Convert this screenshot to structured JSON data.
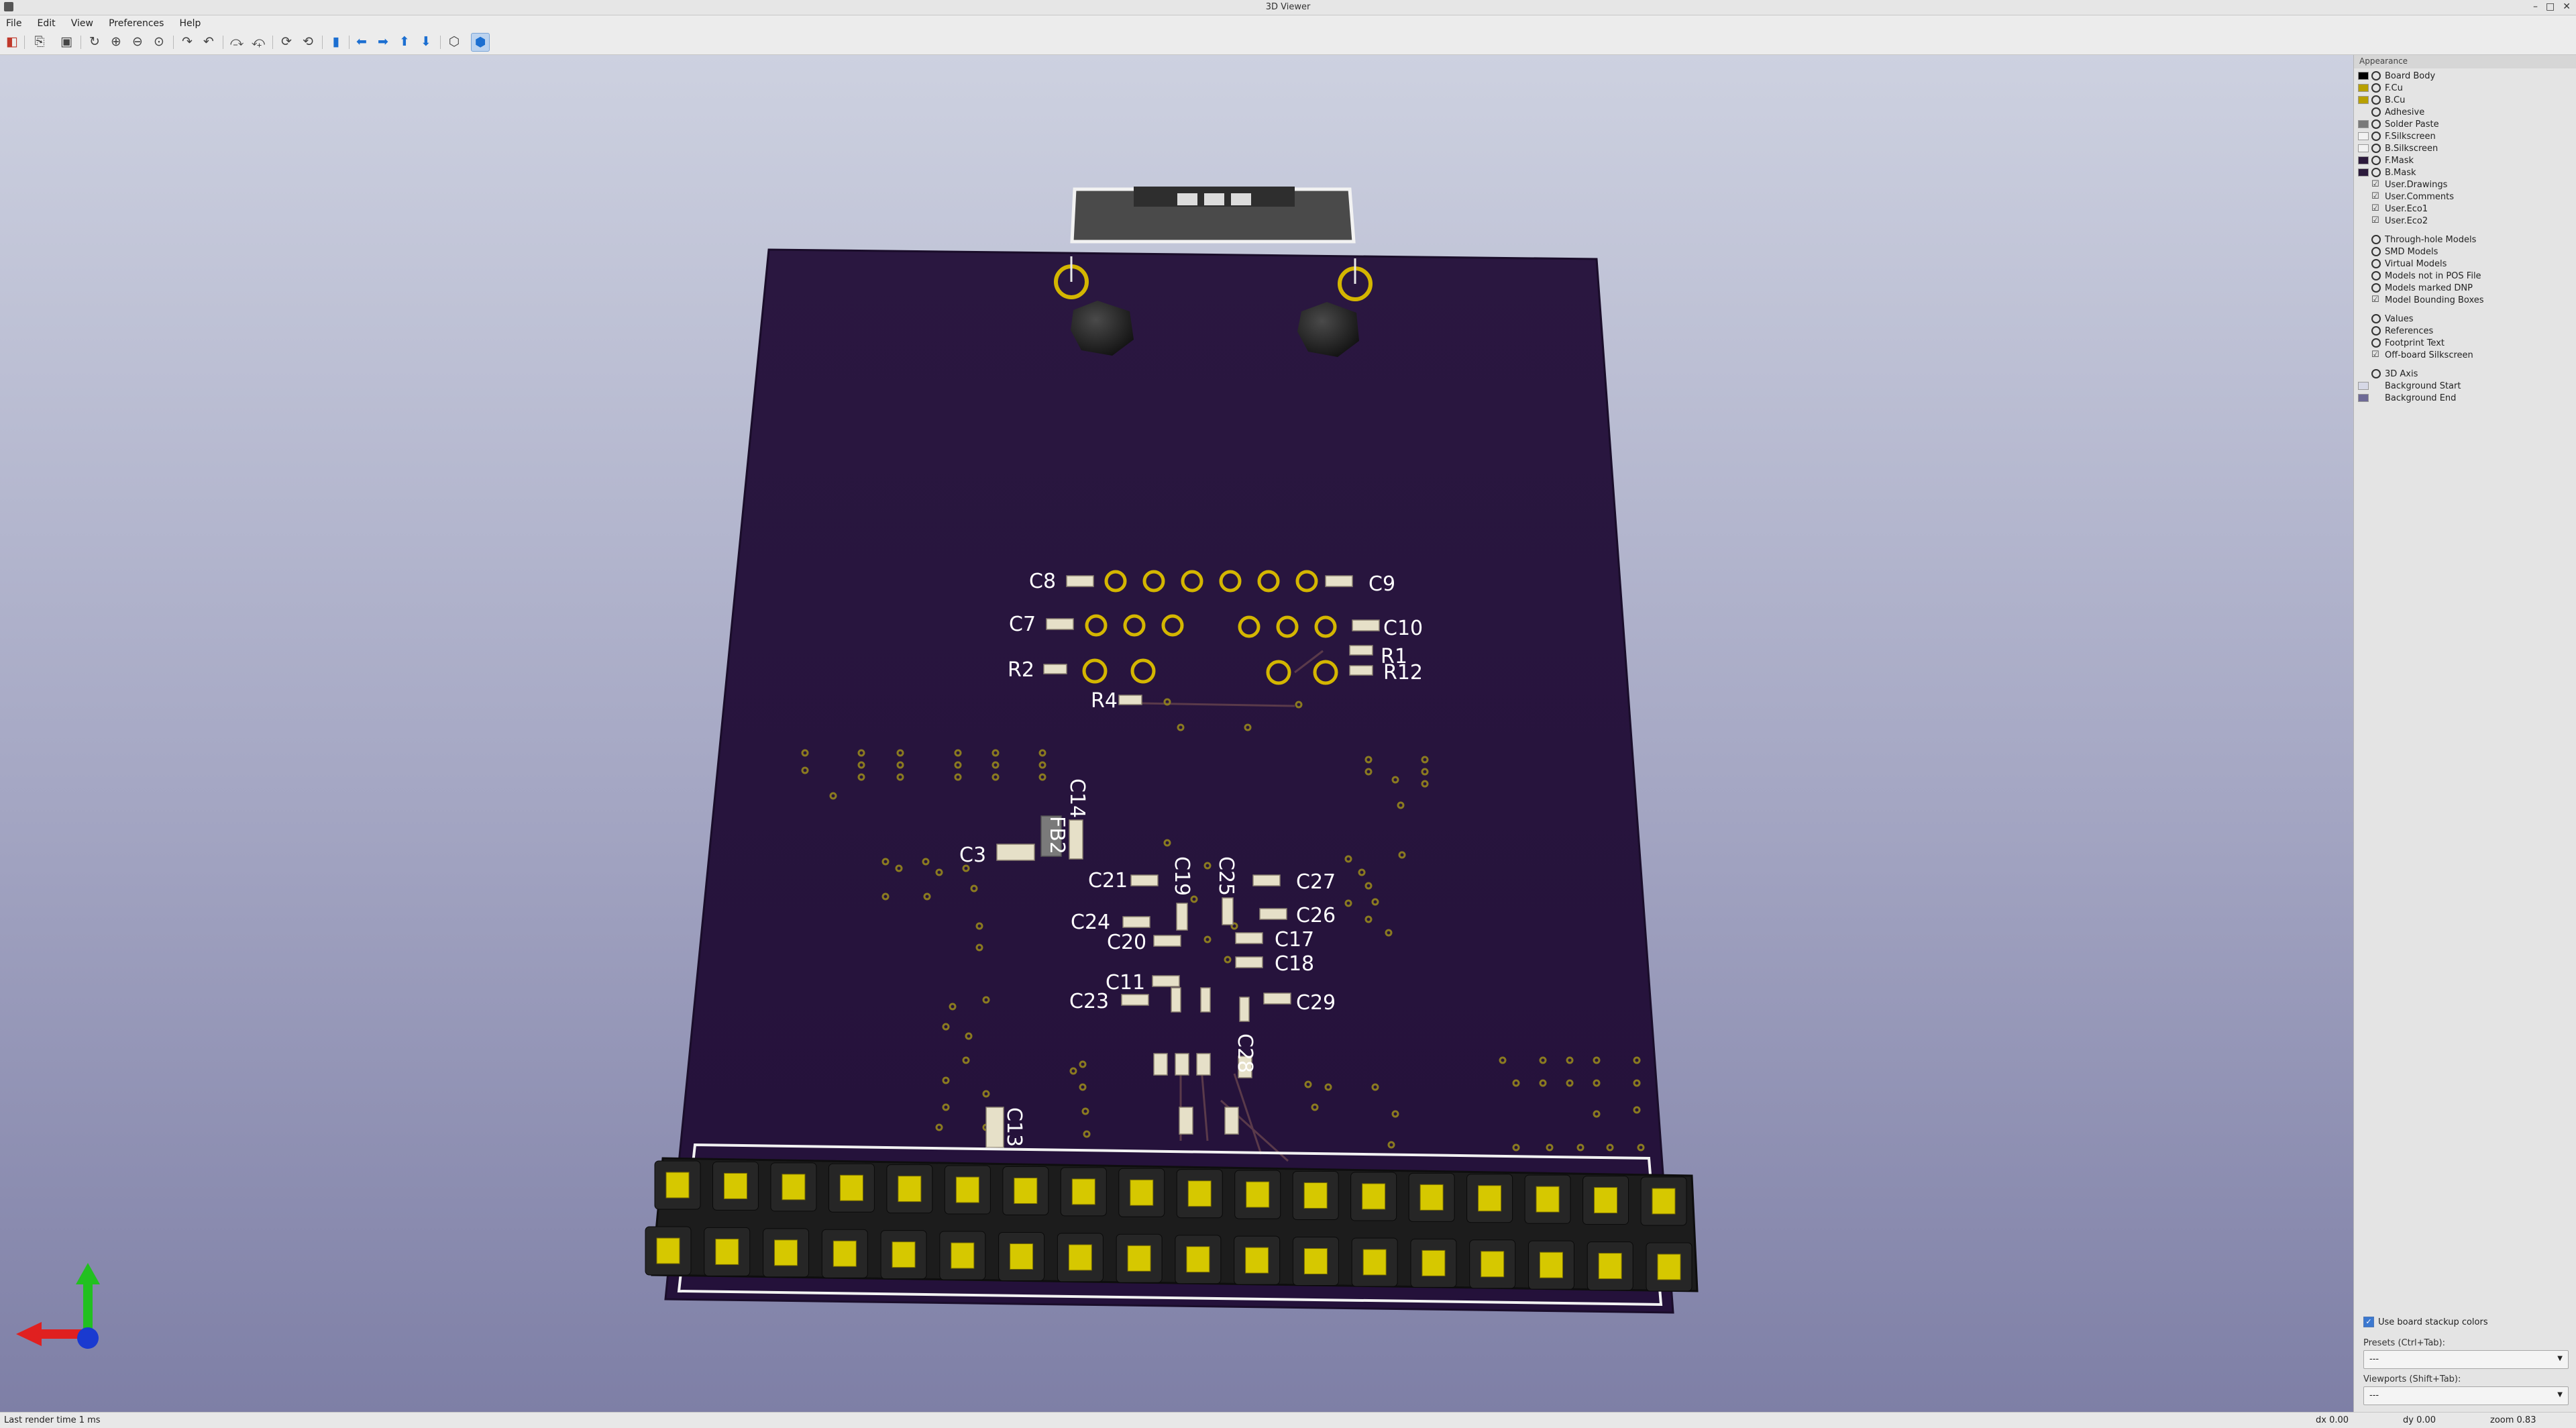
{
  "window": {
    "title": "3D Viewer",
    "controls": [
      "–",
      "□",
      "✕"
    ]
  },
  "menu": [
    "File",
    "Edit",
    "View",
    "Preferences",
    "Help"
  ],
  "toolbar": {
    "icons": [
      "render-raytracing-icon",
      "copy-to-clipboard-icon",
      "export-image-icon",
      "reload-icon",
      "zoom-in-icon",
      "zoom-out-icon",
      "zoom-fit-icon",
      "rotate-x-cw-icon",
      "rotate-x-ccw-icon",
      "rotate-y-cw-icon",
      "rotate-y-ccw-icon",
      "rotate-z-cw-icon",
      "rotate-z-ccw-icon",
      "flip-board-icon",
      "pan-left-icon",
      "pan-right-icon",
      "pan-up-icon",
      "pan-down-icon",
      "orthographic-icon",
      "toggle-3d-models-icon"
    ]
  },
  "appearance": {
    "title": "Appearance",
    "layers": [
      {
        "label": "Board Body",
        "color": "#000000",
        "control": "eye"
      },
      {
        "label": "F.Cu",
        "color": "#b8a000",
        "control": "eye"
      },
      {
        "label": "B.Cu",
        "color": "#b8a000",
        "control": "eye"
      },
      {
        "label": "Adhesive",
        "color": "",
        "control": "eye"
      },
      {
        "label": "Solder Paste",
        "color": "#7a7a7a",
        "control": "eye"
      },
      {
        "label": "F.Silkscreen",
        "color": "#f2f2f2",
        "control": "eye"
      },
      {
        "label": "B.Silkscreen",
        "color": "#f2f2f2",
        "control": "eye"
      },
      {
        "label": "F.Mask",
        "color": "#2c1a3c",
        "control": "eye"
      },
      {
        "label": "B.Mask",
        "color": "#2c1a3c",
        "control": "eye"
      },
      {
        "label": "User.Drawings",
        "color": "",
        "control": "check"
      },
      {
        "label": "User.Comments",
        "color": "",
        "control": "check"
      },
      {
        "label": "User.Eco1",
        "color": "",
        "control": "check"
      },
      {
        "label": "User.Eco2",
        "color": "",
        "control": "check"
      }
    ],
    "models": [
      {
        "label": "Through-hole Models",
        "control": "eye"
      },
      {
        "label": "SMD Models",
        "control": "eye"
      },
      {
        "label": "Virtual Models",
        "control": "eye"
      },
      {
        "label": "Models not in POS File",
        "control": "eye"
      },
      {
        "label": "Models marked DNP",
        "control": "eye"
      },
      {
        "label": "Model Bounding Boxes",
        "control": "check"
      }
    ],
    "texts": [
      {
        "label": "Values",
        "control": "eye"
      },
      {
        "label": "References",
        "control": "eye"
      },
      {
        "label": "Footprint Text",
        "control": "eye"
      },
      {
        "label": "Off-board Silkscreen",
        "control": "check"
      }
    ],
    "misc": [
      {
        "label": "3D Axis",
        "color": "",
        "control": "eye"
      },
      {
        "label": "Background Start",
        "color": "#d6d8e6",
        "control": "none"
      },
      {
        "label": "Background End",
        "color": "#6e6a96",
        "control": "none"
      }
    ],
    "use_stackup_colors": "Use board stackup colors",
    "presets_label": "Presets (Ctrl+Tab):",
    "presets_value": "---",
    "viewports_label": "Viewports (Shift+Tab):",
    "viewports_value": "---"
  },
  "board": {
    "references": [
      "C8",
      "C9",
      "C7",
      "C10",
      "R2",
      "R1",
      "R12",
      "R4",
      "FB2",
      "C14",
      "C3",
      "C21",
      "C19",
      "C25",
      "C27",
      "C26",
      "C24",
      "C20",
      "C17",
      "C18",
      "C11",
      "C23",
      "C29",
      "C28",
      "C13"
    ]
  },
  "status": {
    "left": "Last render time 1 ms",
    "dx": "dx 0.00",
    "dy": "dy 0.00",
    "zoom": "zoom 0.83"
  }
}
